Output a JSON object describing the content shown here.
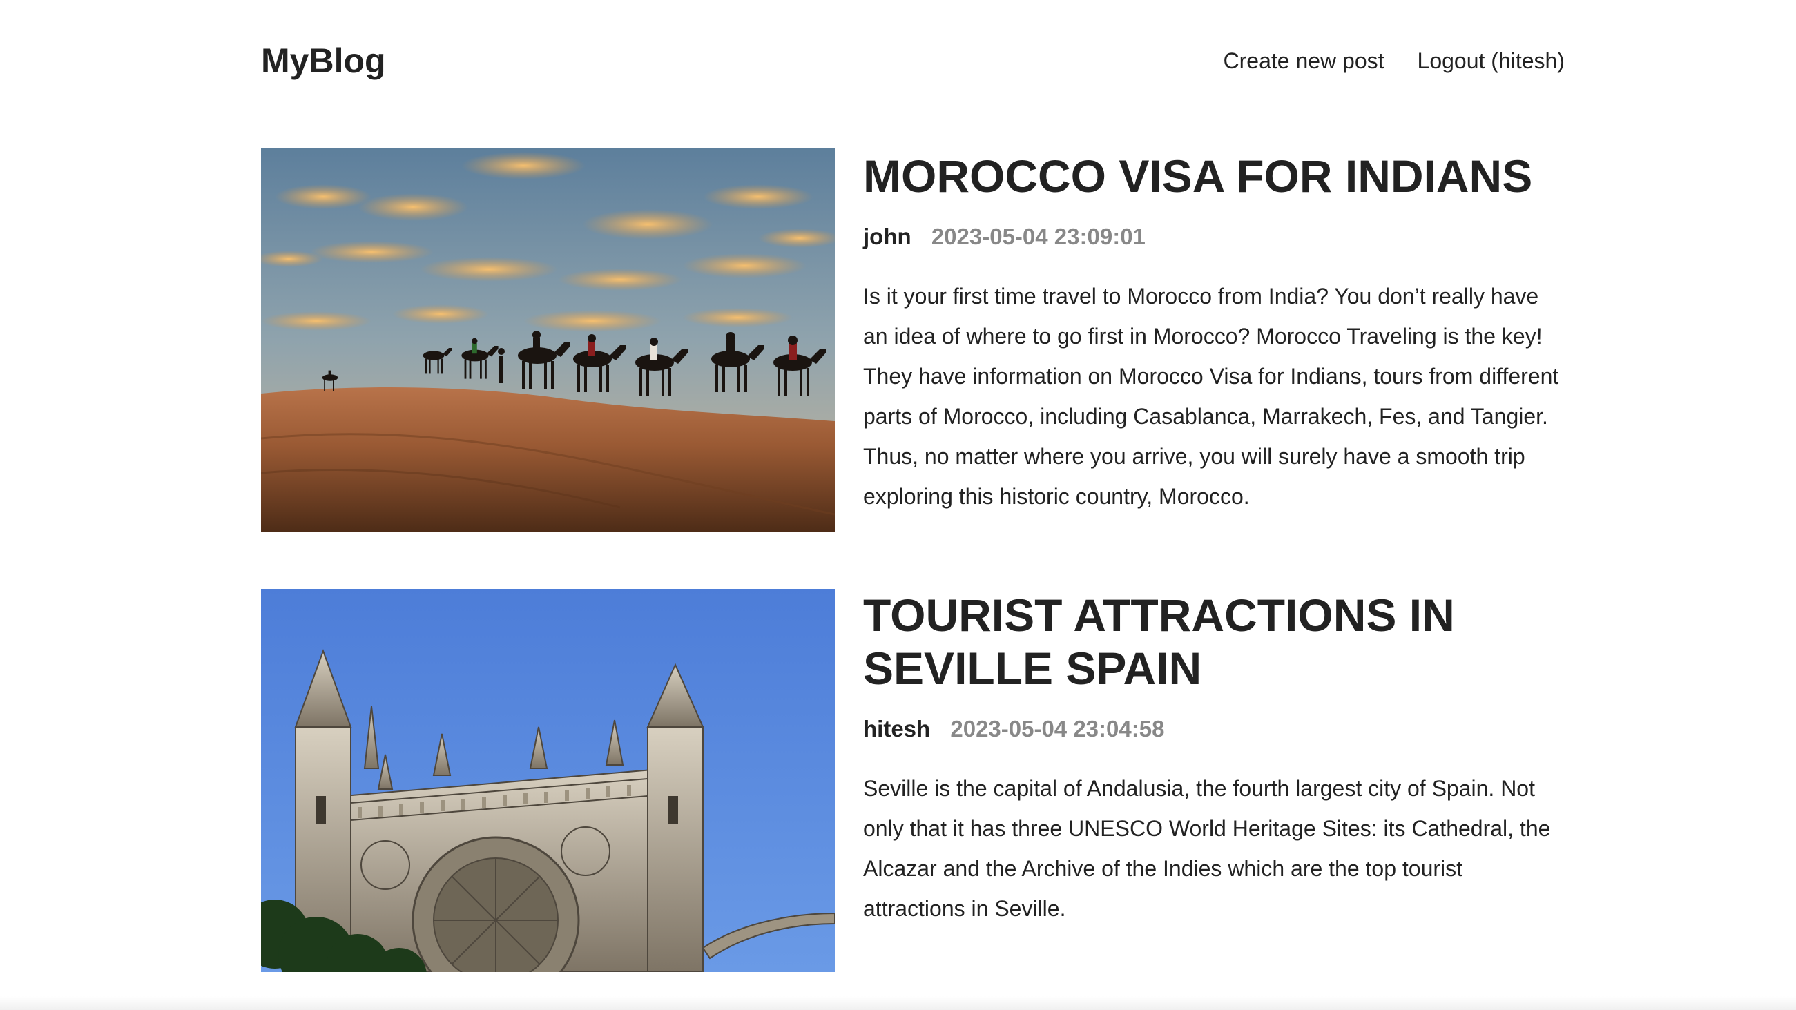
{
  "header": {
    "logo": "MyBlog",
    "nav": {
      "create_post": "Create new post",
      "logout": "Logout (hitesh)"
    }
  },
  "posts": [
    {
      "title": "MOROCCO VISA FOR INDIANS",
      "author": "john",
      "timestamp": "2023-05-04 23:09:01",
      "summary": "Is it your first time travel to Morocco from India? You don’t really have an idea of where to go first in Morocco? Morocco Traveling is the key! They have information on Morocco Visa for Indians, tours from different parts of Morocco, including Casablanca, Marrakech, Fes, and Tangier. Thus, no matter where you arrive, you will surely have a smooth trip exploring this historic country, Morocco."
    },
    {
      "title": "TOURIST ATTRACTIONS IN SEVILLE SPAIN",
      "author": "hitesh",
      "timestamp": "2023-05-04 23:04:58",
      "summary": "Seville is the capital of Andalusia, the fourth largest city of Spain. Not only that it has three UNESCO World Heritage Sites: its Cathedral, the Alcazar and the Archive of the Indies which are the top tourist attractions in Seville."
    }
  ],
  "colors": {
    "text": "#222222",
    "muted": "#888888",
    "background": "#ffffff"
  }
}
